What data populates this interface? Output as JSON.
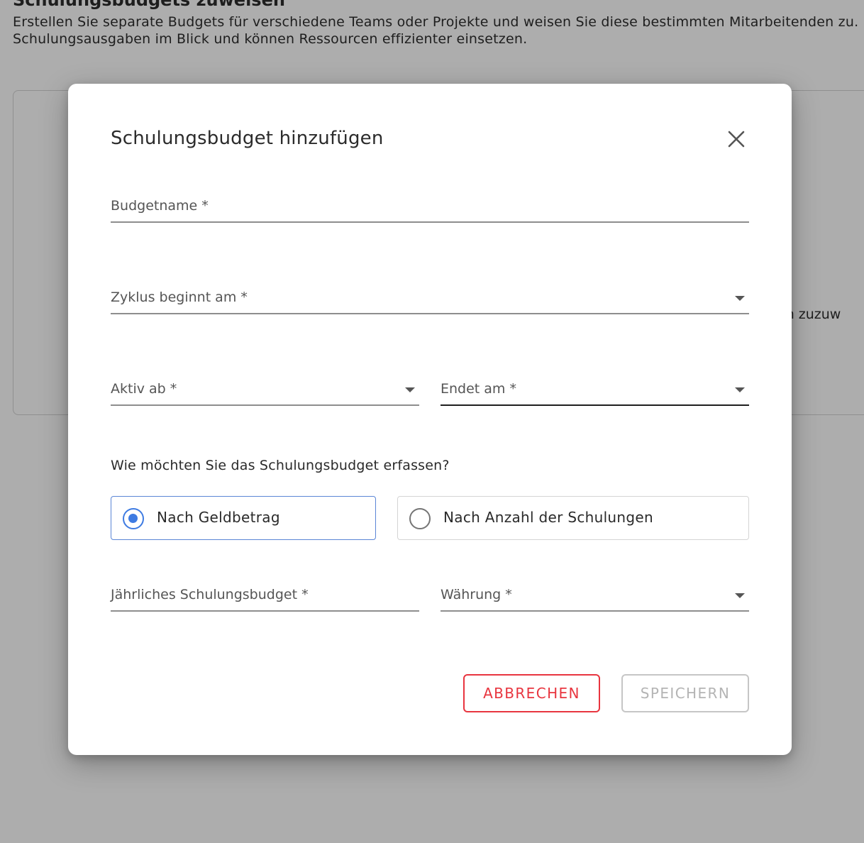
{
  "background": {
    "heading_fragment": "Schulungsbudgets zuweisen",
    "description_lines": [
      "Erstellen Sie separate Budgets für verschiedene Teams oder Projekte und weisen Sie diese bestimmten Mitarbeitenden zu.",
      "Schulungsausgaben im Blick und können Ressourcen effizienter einsetzen."
    ],
    "card_text_fragment": "en zuzuw"
  },
  "dialog": {
    "title": "Schulungsbudget hinzufügen",
    "close_icon": "close-icon",
    "fields": {
      "budget_name": {
        "label": "Budgetname *",
        "value": ""
      },
      "cycle_start": {
        "label": "Zyklus beginnt am *",
        "value": ""
      },
      "active_from": {
        "label": "Aktiv ab *",
        "value": ""
      },
      "ends_on": {
        "label": "Endet am *",
        "value": ""
      },
      "annual_budget": {
        "label": "Jährliches Schulungsbudget *",
        "value": ""
      },
      "currency": {
        "label": "Währung *",
        "value": ""
      }
    },
    "question": "Wie möchten Sie das Schulungsbudget erfassen?",
    "options": [
      {
        "label": "Nach Geldbetrag",
        "selected": true
      },
      {
        "label": "Nach Anzahl der Schulungen",
        "selected": false
      }
    ],
    "buttons": {
      "cancel": "Abbrechen",
      "save": "Speichern"
    },
    "colors": {
      "accent": "#3e7be2",
      "cancel": "#e8353f",
      "disabled": "#b4b4b4",
      "overlay": "#adadad"
    }
  }
}
